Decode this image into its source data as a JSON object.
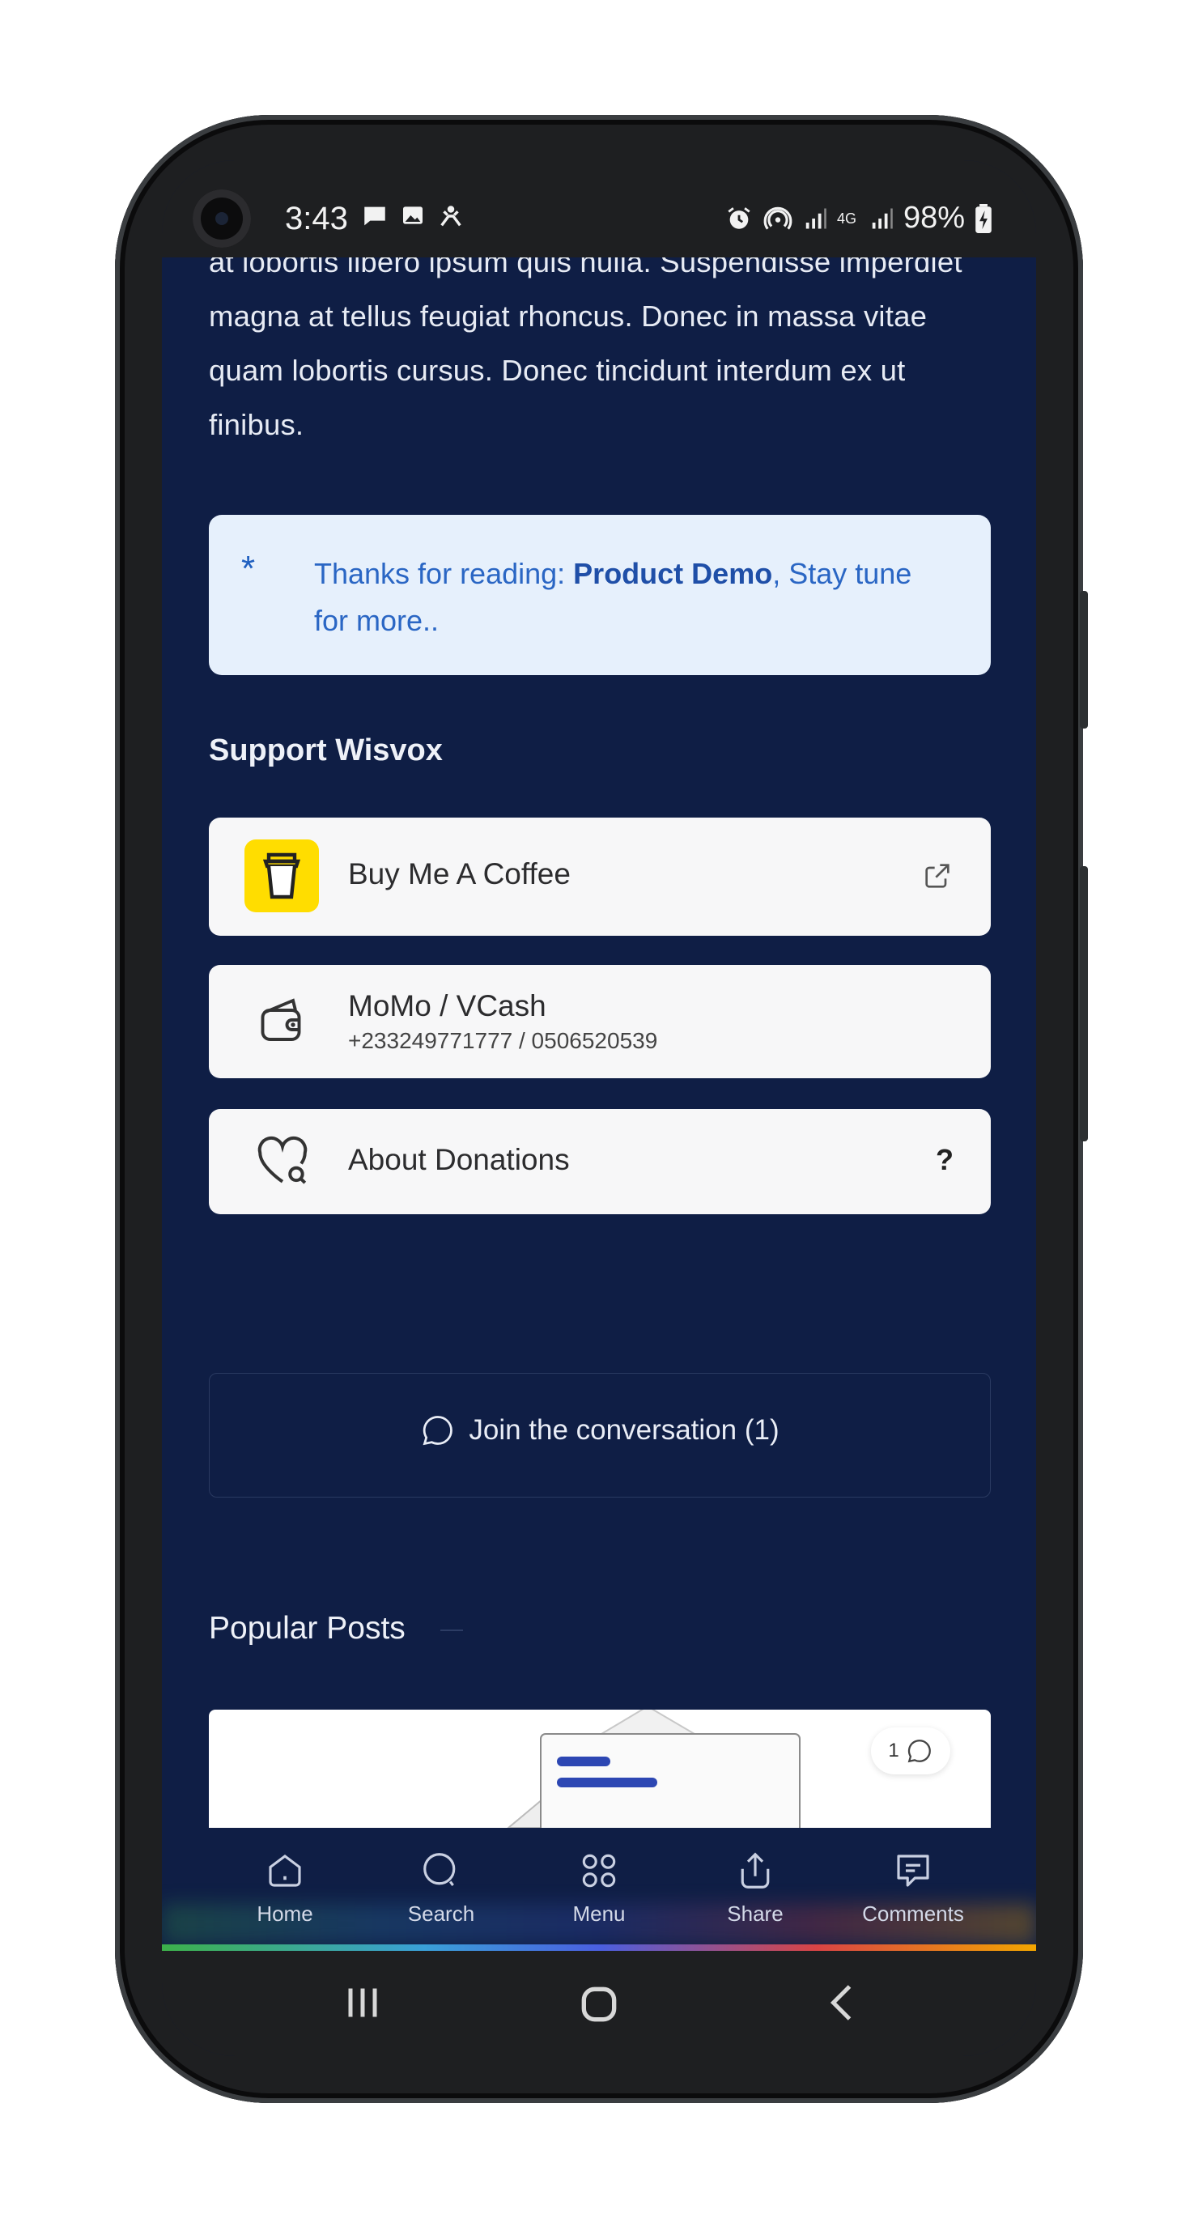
{
  "status_bar": {
    "time": "3:43",
    "left_icons": [
      "chat-icon",
      "image-icon",
      "notification-icon"
    ],
    "right_icons": [
      "alarm-icon",
      "hotspot-icon",
      "signal-icon",
      "4g-icon",
      "signal-icon"
    ],
    "battery": "98%",
    "network_label": "4G"
  },
  "article": {
    "paragraph": "at lobortis libero ipsum quis nulla. Suspendisse imperdiet magna at tellus feugiat rhoncus. Donec in massa vitae quam lobortis cursus. Donec tincidunt interdum ex ut finibus."
  },
  "notice": {
    "asterisk": "*",
    "prefix": "Thanks for reading: ",
    "post_title": "Product Demo",
    "suffix": ", Stay tune for more.."
  },
  "support": {
    "title": "Support Wisvox",
    "coffee_label": "Buy Me A Coffee",
    "momo_label": "MoMo / VCash",
    "momo_numbers": "+233249771777 / 0506520539",
    "donations_label": "About Donations",
    "donations_help": "?"
  },
  "conversation": {
    "label": "Join the conversation (1)"
  },
  "popular": {
    "title": "Popular Posts",
    "comment_count": "1"
  },
  "bottom_nav": {
    "home": "Home",
    "search": "Search",
    "menu": "Menu",
    "share": "Share",
    "comments": "Comments"
  },
  "colors": {
    "page_bg": "#0f1e45",
    "notice_bg": "#e6f0fc",
    "notice_text": "#2a66c4",
    "card_bg": "#f7f7f8",
    "coffee_yellow": "#ffdd00"
  }
}
